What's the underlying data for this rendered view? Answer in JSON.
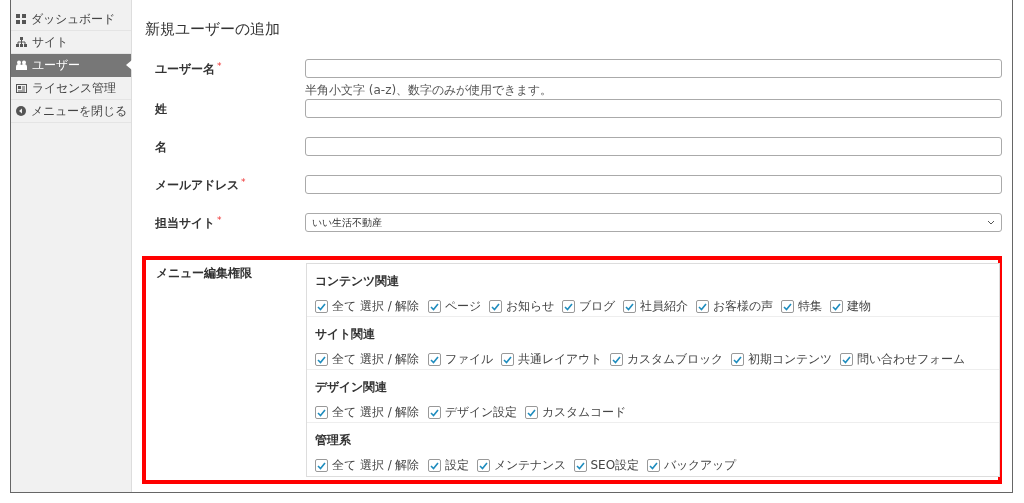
{
  "sidebar": {
    "items": [
      {
        "label": "ダッシュボード",
        "selected": false
      },
      {
        "label": "サイト",
        "selected": false
      },
      {
        "label": "ユーザー",
        "selected": true
      },
      {
        "label": "ライセンス管理",
        "selected": false
      },
      {
        "label": "メニューを閉じる",
        "selected": false
      }
    ]
  },
  "page_title": "新規ユーザーの追加",
  "fields": [
    {
      "kind": "text",
      "label": "ユーザー名",
      "required_mark": "*",
      "hint": "半角小文字 (a-z)、数字のみが使用できます。"
    },
    {
      "kind": "text",
      "label": "姓"
    },
    {
      "kind": "text",
      "label": "名"
    },
    {
      "kind": "text",
      "label": "メールアドレス",
      "required_mark": "*"
    },
    {
      "kind": "select",
      "label": "担当サイト",
      "required_mark": "*",
      "value": "いい生活不動産"
    }
  ],
  "permissions": {
    "label": "メニュー編集権限",
    "highlighted": true,
    "groups": [
      {
        "title": "コンテンツ関連",
        "options": [
          {
            "label": "全て 選択 / 解除",
            "checked": true
          },
          {
            "label": "ページ",
            "checked": true
          },
          {
            "label": "お知らせ",
            "checked": true
          },
          {
            "label": "ブログ",
            "checked": true
          },
          {
            "label": "社員紹介",
            "checked": true
          },
          {
            "label": "お客様の声",
            "checked": true
          },
          {
            "label": "特集",
            "checked": true
          },
          {
            "label": "建物",
            "checked": true
          }
        ]
      },
      {
        "title": "サイト関連",
        "options": [
          {
            "label": "全て 選択 / 解除",
            "checked": true
          },
          {
            "label": "ファイル",
            "checked": true
          },
          {
            "label": "共通レイアウト",
            "checked": true
          },
          {
            "label": "カスタムブロック",
            "checked": true
          },
          {
            "label": "初期コンテンツ",
            "checked": true
          },
          {
            "label": "問い合わせフォーム",
            "checked": true
          }
        ]
      },
      {
        "title": "デザイン関連",
        "options": [
          {
            "label": "全て 選択 / 解除",
            "checked": true
          },
          {
            "label": "デザイン設定",
            "checked": true
          },
          {
            "label": "カスタムコード",
            "checked": true
          }
        ]
      },
      {
        "title": "管理系",
        "options": [
          {
            "label": "全て 選択 / 解除",
            "checked": true
          },
          {
            "label": "設定",
            "checked": true
          },
          {
            "label": "メンテナンス",
            "checked": true
          },
          {
            "label": "SEO設定",
            "checked": true
          },
          {
            "label": "バックアップ",
            "checked": true
          }
        ]
      }
    ]
  }
}
